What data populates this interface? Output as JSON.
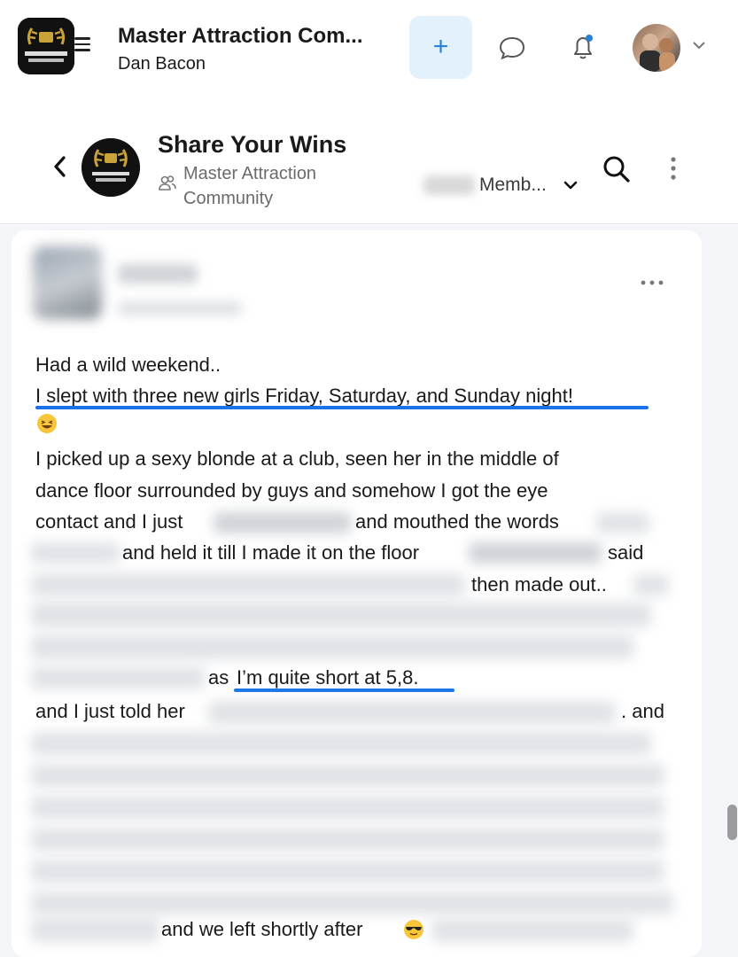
{
  "app": {
    "title": "Master Attraction Com...",
    "subtitle": "Dan Bacon",
    "plus_symbol": "+",
    "icons": {
      "menu": "hamburger-icon",
      "chat": "chat-bubble-icon",
      "notifications": "bell-icon",
      "account_menu": "chevron-down-icon"
    },
    "accent_color": "#2b7fd6",
    "accent_bg": "#e3f1fc"
  },
  "channel": {
    "title": "Share Your Wins",
    "community": "Master Attraction Community",
    "members_label": "Memb...",
    "icons": {
      "back": "chevron-left-icon",
      "community": "users-icon",
      "members": "chevron-down-icon",
      "search": "search-icon",
      "more": "vertical-dots-icon"
    }
  },
  "post": {
    "more_icon": "horizontal-dots-icon",
    "lines": {
      "l1": "Had a wild weekend..",
      "l2": "I slept with three new girls Friday, Saturday, and Sunday night!",
      "l3": "I picked up a sexy blonde at a club, seen her in the middle of",
      "l4": "dance floor surrounded by guys and somehow I got the eye",
      "l5a": "contact and I just",
      "l5b": "and mouthed the words",
      "l6a": "and held it till I made it on the floor",
      "l6b": "said",
      "l7": "then made out..",
      "l8a": "as",
      "l8b": "I’m quite short at 5,8.",
      "l9a": "and I just told her",
      "l9b": ". and",
      "l10": "and we left shortly after"
    },
    "emojis": [
      "laughing-face-emoji",
      "sunglasses-face-emoji"
    ],
    "highlight_color": "#1a73e8"
  }
}
